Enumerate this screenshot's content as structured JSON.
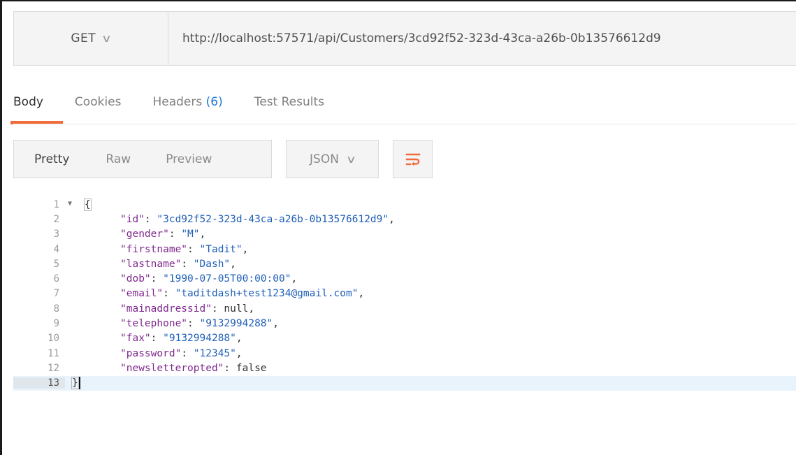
{
  "request": {
    "method": "GET",
    "url": "http://localhost:57571/api/Customers/3cd92f52-323d-43ca-a26b-0b13576612d9"
  },
  "response_tabs": [
    {
      "label": "Body",
      "count": ""
    },
    {
      "label": "Cookies",
      "count": ""
    },
    {
      "label": "Headers",
      "count": "(6)"
    },
    {
      "label": "Test Results",
      "count": ""
    }
  ],
  "view_modes": [
    "Pretty",
    "Raw",
    "Preview"
  ],
  "format": "JSON",
  "icons": {
    "method_chevron": "chevron-down-icon",
    "format_chevron": "chevron-down-icon",
    "wrap": "wrap-lines-icon",
    "fold": "fold-arrow-icon"
  },
  "colors": {
    "accent": "#f26b3a",
    "key": "#802a8e",
    "string": "#1f5fb8",
    "link": "#1f7ad6"
  },
  "body": {
    "line_numbers": [
      "1",
      "2",
      "3",
      "4",
      "5",
      "6",
      "7",
      "8",
      "9",
      "10",
      "11",
      "12",
      "13"
    ],
    "open_brace": "{",
    "close_brace": "}",
    "fields": [
      {
        "key": "\"id\"",
        "value": "\"3cd92f52-323d-43ca-a26b-0b13576612d9\"",
        "sep": ",",
        "type": "string"
      },
      {
        "key": "\"gender\"",
        "value": "\"M\"",
        "sep": ",",
        "type": "string"
      },
      {
        "key": "\"firstname\"",
        "value": "\"Tadit\"",
        "sep": ",",
        "type": "string"
      },
      {
        "key": "\"lastname\"",
        "value": "\"Dash\"",
        "sep": ",",
        "type": "string"
      },
      {
        "key": "\"dob\"",
        "value": "\"1990-07-05T00:00:00\"",
        "sep": ",",
        "type": "string"
      },
      {
        "key": "\"email\"",
        "value": "\"taditdash+test1234@gmail.com\"",
        "sep": ",",
        "type": "string"
      },
      {
        "key": "\"mainaddressid\"",
        "value": "null",
        "sep": ",",
        "type": "literal"
      },
      {
        "key": "\"telephone\"",
        "value": "\"9132994288\"",
        "sep": ",",
        "type": "string"
      },
      {
        "key": "\"fax\"",
        "value": "\"9132994288\"",
        "sep": ",",
        "type": "string"
      },
      {
        "key": "\"password\"",
        "value": "\"12345\"",
        "sep": ",",
        "type": "string"
      },
      {
        "key": "\"newsletteropted\"",
        "value": "false",
        "sep": "",
        "type": "literal"
      }
    ]
  }
}
